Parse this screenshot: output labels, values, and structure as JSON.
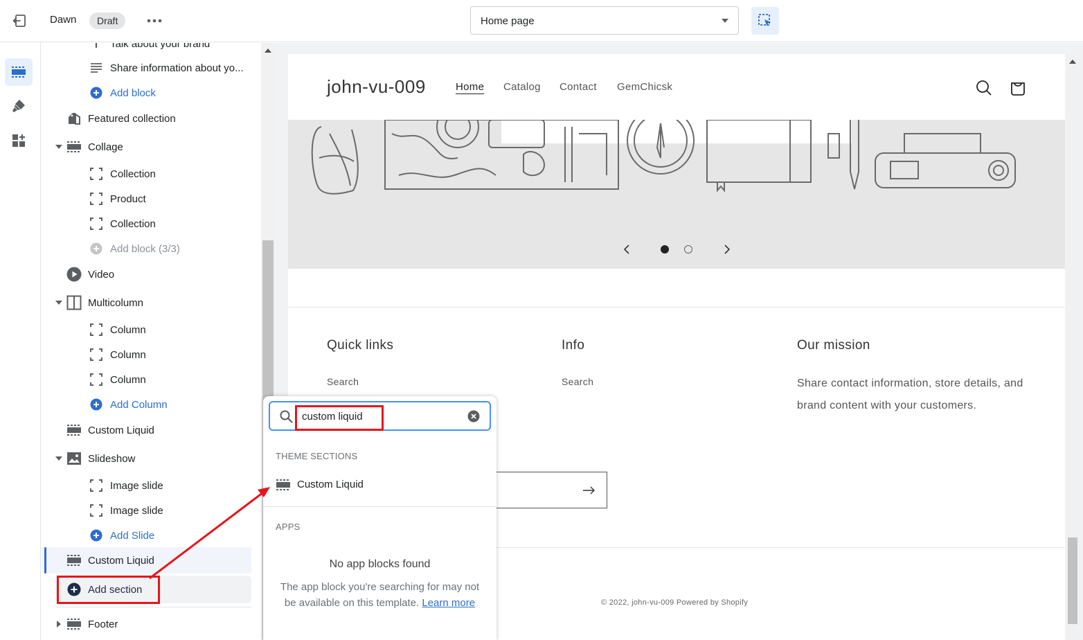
{
  "topbar": {
    "theme_name": "Dawn",
    "status_badge": "Draft",
    "page_select": "Home page"
  },
  "sidebar": {
    "items": [
      {
        "label": "Talk about your brand"
      },
      {
        "label": "Share information about yo..."
      },
      {
        "label": "Add block"
      },
      {
        "label": "Featured collection"
      },
      {
        "label": "Collage"
      },
      {
        "label": "Collection"
      },
      {
        "label": "Product"
      },
      {
        "label": "Collection"
      },
      {
        "label": "Add block (3/3)"
      },
      {
        "label": "Video"
      },
      {
        "label": "Multicolumn"
      },
      {
        "label": "Column"
      },
      {
        "label": "Column"
      },
      {
        "label": "Column"
      },
      {
        "label": "Add Column"
      },
      {
        "label": "Custom Liquid"
      },
      {
        "label": "Slideshow"
      },
      {
        "label": "Image slide"
      },
      {
        "label": "Image slide"
      },
      {
        "label": "Add Slide"
      },
      {
        "label": "Custom Liquid"
      },
      {
        "label": "Add section"
      },
      {
        "label": "Footer"
      }
    ]
  },
  "store": {
    "logo": "john-vu-009",
    "nav": [
      "Home",
      "Catalog",
      "Contact",
      "GemChicsk"
    ],
    "footer": {
      "quick_links_heading": "Quick links",
      "quick_links_item": "Search",
      "info_heading": "Info",
      "info_item": "Search",
      "mission_heading": "Our mission",
      "mission_text": "Share contact information, store details, and brand content with your customers."
    },
    "copyright": "© 2022, john-vu-009 Powered by Shopify"
  },
  "popover": {
    "search_value": "custom liquid",
    "theme_sections_heading": "THEME SECTIONS",
    "result_label": "Custom Liquid",
    "apps_heading": "APPS",
    "no_app_title": "No app blocks found",
    "no_app_desc": "The app block you're searching for may not be available on this template.",
    "learn_more": "Learn more"
  },
  "colors": {
    "accent": "#2c6ecb",
    "annotation": "#e8141b",
    "hero_bg": "#e6e6e6"
  }
}
